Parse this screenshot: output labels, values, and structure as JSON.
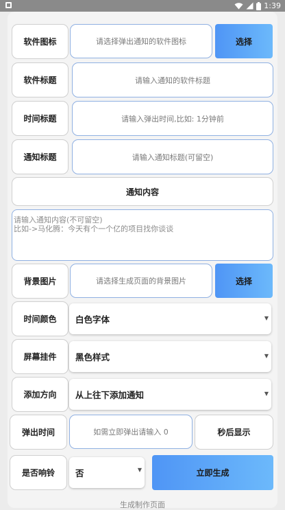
{
  "status": {
    "time": "1:39"
  },
  "form": {
    "icon": {
      "label": "软件图标",
      "placeholder": "请选择弹出通知的软件图标",
      "button": "选择"
    },
    "app_title": {
      "label": "软件标题",
      "placeholder": "请输入通知的软件标题"
    },
    "time_title": {
      "label": "时间标题",
      "placeholder": "请输入弹出时间,比如: 1分钟前"
    },
    "notify_title": {
      "label": "通知标题",
      "placeholder": "请输入通知标题(可留空)"
    },
    "content": {
      "header": "通知内容",
      "placeholder_line1": "请输入通知内容(不可留空)",
      "placeholder_line2": "比如->马化腾：今天有个一个亿的项目找你谈谈"
    },
    "background": {
      "label": "背景图片",
      "placeholder": "请选择生成页面的背景图片",
      "button": "选择"
    },
    "time_color": {
      "label": "时间颜色",
      "value": "白色字体"
    },
    "screen_widget": {
      "label": "屏幕挂件",
      "value": "黑色样式"
    },
    "add_direction": {
      "label": "添加方向",
      "value": "从上往下添加通知"
    },
    "popup_time": {
      "label": "弹出时间",
      "placeholder": "如需立即弹出请输入 0",
      "suffix": "秒后显示"
    },
    "ring": {
      "label": "是否响铃",
      "value": "否"
    },
    "generate_button": "立即生成"
  },
  "footer": {
    "text": "生成制作页面"
  }
}
